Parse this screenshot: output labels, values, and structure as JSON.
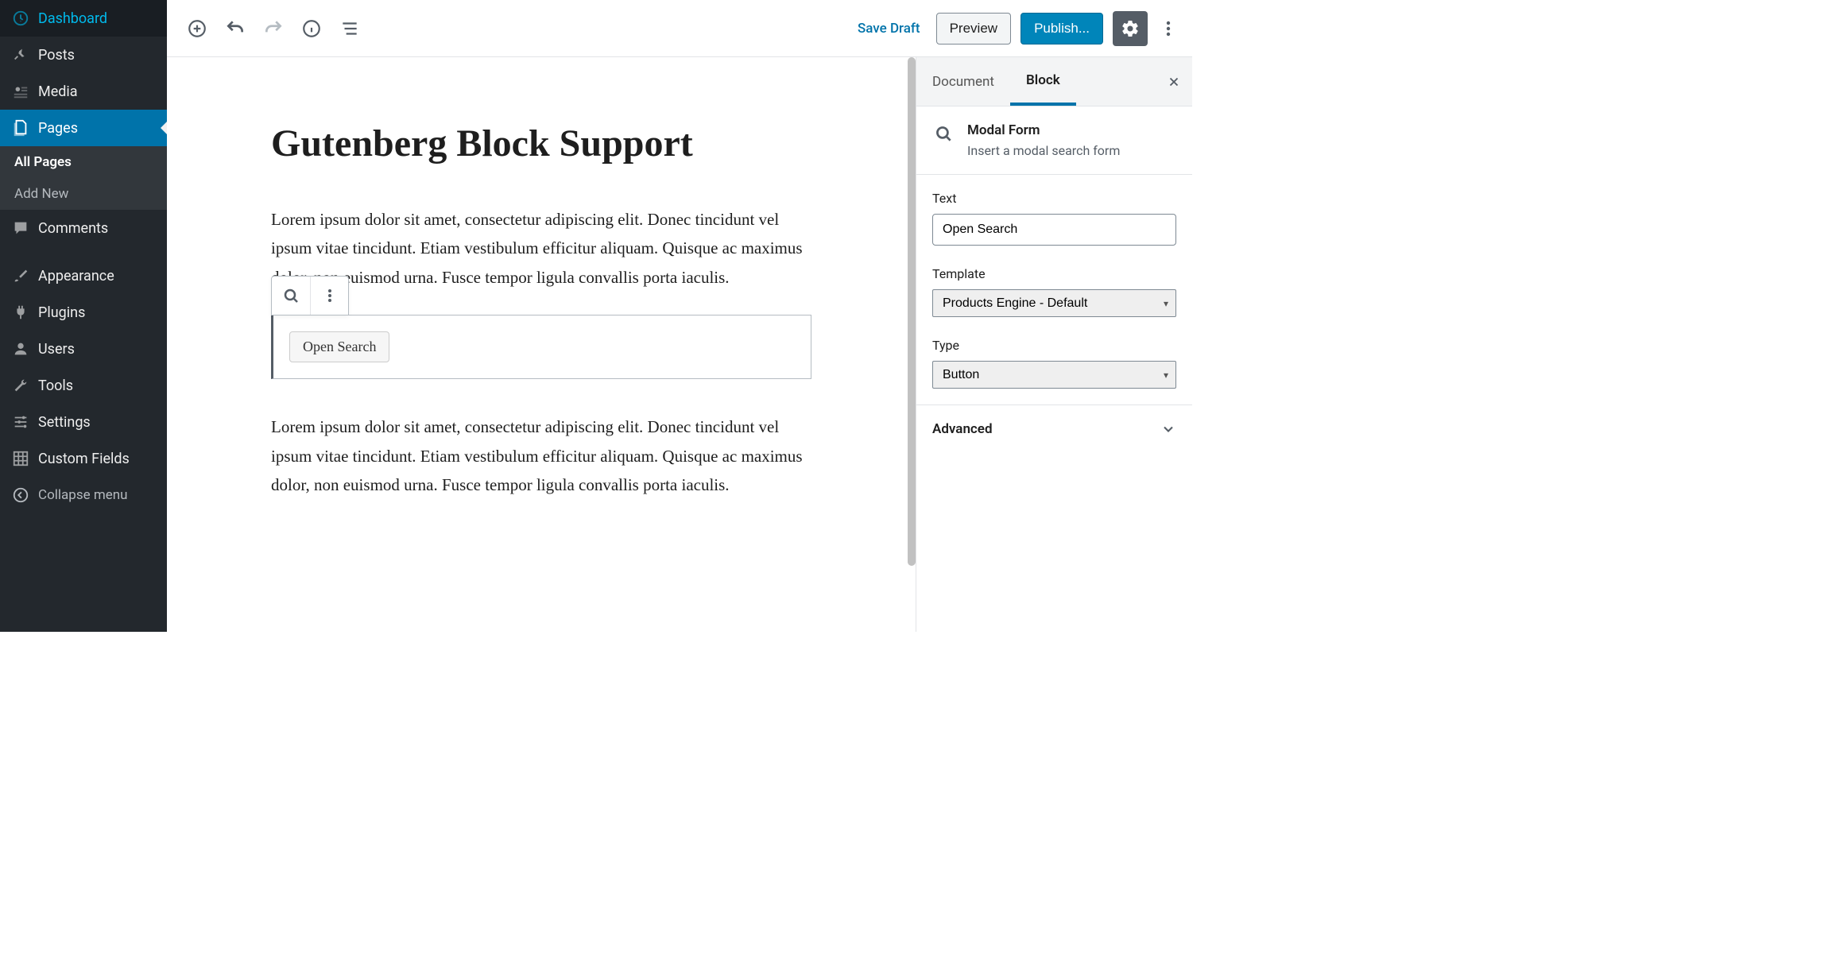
{
  "sidebar": {
    "items": [
      {
        "label": "Dashboard",
        "icon": "dashboard-icon"
      },
      {
        "label": "Posts",
        "icon": "pin-icon"
      },
      {
        "label": "Media",
        "icon": "media-icon"
      },
      {
        "label": "Pages",
        "icon": "pages-icon",
        "active": true
      },
      {
        "label": "Comments",
        "icon": "comment-icon"
      },
      {
        "label": "Appearance",
        "icon": "brush-icon"
      },
      {
        "label": "Plugins",
        "icon": "plug-icon"
      },
      {
        "label": "Users",
        "icon": "user-icon"
      },
      {
        "label": "Tools",
        "icon": "wrench-icon"
      },
      {
        "label": "Settings",
        "icon": "sliders-icon"
      },
      {
        "label": "Custom Fields",
        "icon": "grid-icon"
      }
    ],
    "sub": {
      "parent": "Pages",
      "items": [
        {
          "label": "All Pages",
          "current": true
        },
        {
          "label": "Add New",
          "current": false
        }
      ]
    },
    "collapse": "Collapse menu"
  },
  "topbar": {
    "save_draft": "Save Draft",
    "preview": "Preview",
    "publish": "Publish..."
  },
  "editor": {
    "title": "Gutenberg Block Support",
    "para1": "Lorem ipsum dolor sit amet, consectetur adipiscing elit. Donec tincidunt vel ipsum vitae tincidunt. Etiam vestibulum efficitur aliquam. Quisque ac maximus dolor, non euismod urna. Fusce tempor ligula convallis porta iaculis.",
    "para2": "Lorem ipsum dolor sit amet, consectetur adipiscing elit. Donec tincidunt vel ipsum vitae tincidunt. Etiam vestibulum efficitur aliquam. Quisque ac maximus dolor, non euismod urna. Fusce tempor ligula convallis porta iaculis.",
    "block_button": "Open Search"
  },
  "inspector": {
    "tabs": {
      "document": "Document",
      "block": "Block"
    },
    "active_tab": "block",
    "block_title": "Modal Form",
    "block_desc": "Insert a modal search form",
    "fields": {
      "text": {
        "label": "Text",
        "value": "Open Search"
      },
      "template": {
        "label": "Template",
        "value": "Products Engine - Default"
      },
      "type": {
        "label": "Type",
        "value": "Button"
      }
    },
    "advanced": "Advanced"
  }
}
